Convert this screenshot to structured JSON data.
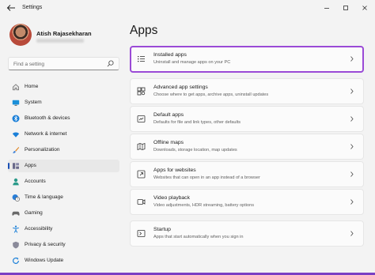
{
  "window": {
    "title": "Settings",
    "back_icon": "arrow-left-icon",
    "controls": [
      "minimize-icon",
      "maximize-icon",
      "close-icon"
    ]
  },
  "profile": {
    "name": "Atish Rajasekharan"
  },
  "search": {
    "placeholder": "Find a setting"
  },
  "sidebar": {
    "selected": "Apps",
    "accent": "#1a4fb5",
    "items": [
      {
        "label": "Home",
        "icon": "home-icon"
      },
      {
        "label": "System",
        "icon": "monitor-icon"
      },
      {
        "label": "Bluetooth & devices",
        "icon": "bluetooth-icon"
      },
      {
        "label": "Network & internet",
        "icon": "wifi-icon"
      },
      {
        "label": "Personalization",
        "icon": "paintbrush-icon"
      },
      {
        "label": "Apps",
        "icon": "apps-icon"
      },
      {
        "label": "Accounts",
        "icon": "person-icon"
      },
      {
        "label": "Time & language",
        "icon": "globe-clock-icon"
      },
      {
        "label": "Gaming",
        "icon": "gamepad-icon"
      },
      {
        "label": "Accessibility",
        "icon": "accessibility-icon"
      },
      {
        "label": "Privacy & security",
        "icon": "shield-icon"
      },
      {
        "label": "Windows Update",
        "icon": "refresh-icon"
      }
    ]
  },
  "main": {
    "title": "Apps",
    "highlight_color": "#9a4ad6",
    "cards": [
      {
        "title": "Installed apps",
        "description": "Uninstall and manage apps on your PC",
        "icon": "list-icon"
      },
      {
        "title": "Advanced app settings",
        "description": "Choose where to get apps, archive apps, uninstall updates",
        "icon": "app-settings-icon"
      },
      {
        "title": "Default apps",
        "description": "Defaults for file and link types, other defaults",
        "icon": "default-apps-icon"
      },
      {
        "title": "Offline maps",
        "description": "Downloads, storage location, map updates",
        "icon": "map-icon"
      },
      {
        "title": "Apps for websites",
        "description": "Websites that can open in an app instead of a browser",
        "icon": "open-in-app-icon"
      },
      {
        "title": "Video playback",
        "description": "Video adjustments, HDR streaming, battery options",
        "icon": "video-icon"
      },
      {
        "title": "Startup",
        "description": "Apps that start automatically when you sign in",
        "icon": "startup-icon"
      }
    ]
  }
}
